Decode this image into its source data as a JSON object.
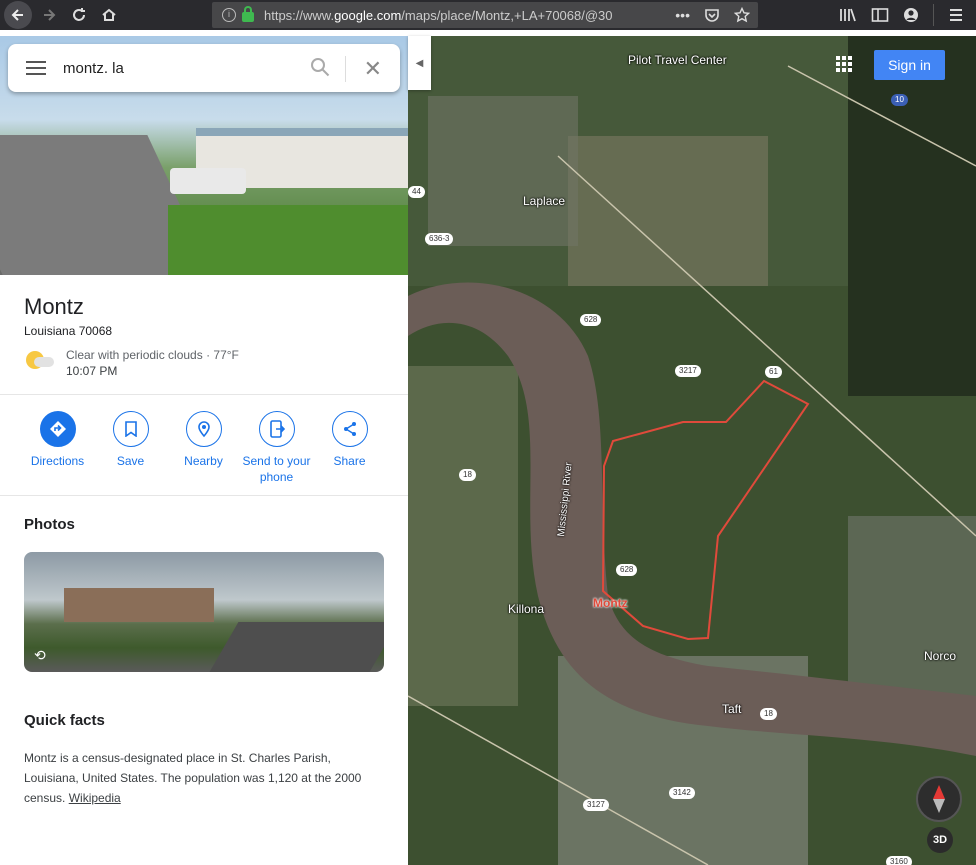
{
  "browser": {
    "url_prefix": "https://www.",
    "url_domain": "google.com",
    "url_rest": "/maps/place/Montz,+LA+70068/@30",
    "more_icon": "ellipsis-icon",
    "pocket_icon": "pocket-icon",
    "bookmark_icon": "star-icon"
  },
  "search": {
    "query": "montz. la"
  },
  "place": {
    "title": "Montz",
    "subtitle": "Louisiana 70068",
    "weather_text": "Clear with periodic clouds · 77°F",
    "weather_time": "10:07 PM"
  },
  "actions": [
    {
      "label": "Directions",
      "icon": "directions-icon"
    },
    {
      "label": "Save",
      "icon": "bookmark-icon"
    },
    {
      "label": "Nearby",
      "icon": "nearby-icon"
    },
    {
      "label": "Send to your phone",
      "icon": "send-to-phone-icon"
    },
    {
      "label": "Share",
      "icon": "share-icon"
    }
  ],
  "photos": {
    "heading": "Photos"
  },
  "quick_facts": {
    "heading": "Quick facts",
    "text": "Montz is a census-designated place in St. Charles Parish, Louisiana, United States. The population was 1,120 at the 2000 census.",
    "link": "Wikipedia"
  },
  "map": {
    "sign_in": "Sign in",
    "btn_3d": "3D",
    "labels": {
      "pilot": "Pilot Travel Center",
      "laplace": "Laplace",
      "killona": "Killona",
      "montz": "Montz",
      "taft": "Taft",
      "norco": "Norco",
      "river": "Mississippi River"
    },
    "shields": {
      "i10": "10",
      "r44": "44",
      "r636": "636-3",
      "r628a": "628",
      "r3217": "3217",
      "r61": "61",
      "r18a": "18",
      "r628b": "628",
      "r18b": "18",
      "r3127": "3127",
      "r3142": "3142",
      "r3160": "3160"
    },
    "colors": {
      "boundary": "#e04a3b",
      "river": "#6b5d57",
      "sign_in": "#4285f4"
    }
  }
}
